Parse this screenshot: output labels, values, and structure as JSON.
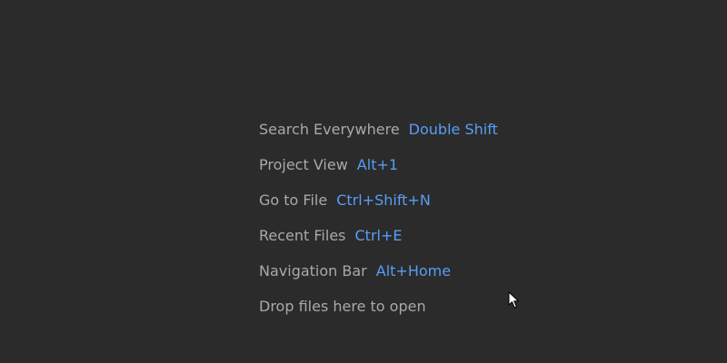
{
  "editor_hints": [
    {
      "label": "Search Everywhere",
      "shortcut": "Double Shift"
    },
    {
      "label": "Project View",
      "shortcut": "Alt+1"
    },
    {
      "label": "Go to File",
      "shortcut": "Ctrl+Shift+N"
    },
    {
      "label": "Recent Files",
      "shortcut": "Ctrl+E"
    },
    {
      "label": "Navigation Bar",
      "shortcut": "Alt+Home"
    }
  ],
  "drop_hint": "Drop files here to open",
  "colors": {
    "background": "#2b2b2b",
    "label": "#a9a9a9",
    "shortcut": "#589df6"
  },
  "cursor_icon": "mouse-pointer-icon"
}
